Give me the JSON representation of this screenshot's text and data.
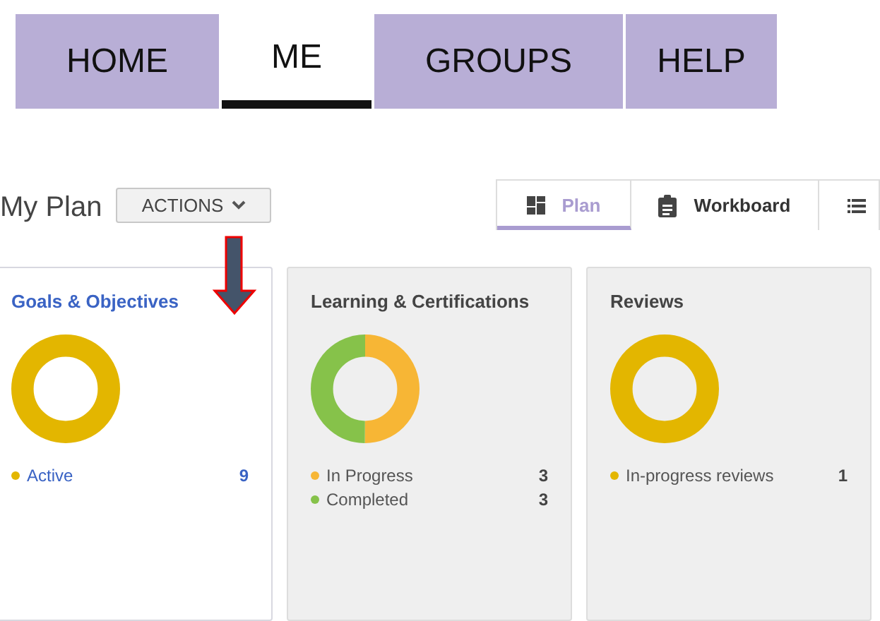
{
  "nav_tabs": [
    {
      "label": "HOME",
      "selected": false
    },
    {
      "label": "ME",
      "selected": true
    },
    {
      "label": "GROUPS",
      "selected": false
    },
    {
      "label": "HELP",
      "selected": false
    }
  ],
  "page_title": "My Plan",
  "actions_button": {
    "label": "ACTIONS"
  },
  "view_tabs": [
    {
      "label": "Plan",
      "selected": true
    },
    {
      "label": "Workboard",
      "selected": false
    },
    {
      "selected": false
    }
  ],
  "cards": [
    {
      "title": "Goals & Objectives",
      "selected": true,
      "legend": [
        {
          "label": "Active",
          "count": "9",
          "color": "#e3b600"
        }
      ]
    },
    {
      "title": "Learning & Certifications",
      "selected": false,
      "legend": [
        {
          "label": "In Progress",
          "count": "3",
          "color": "#f7b635"
        },
        {
          "label": "Completed",
          "count": "3",
          "color": "#86c24a"
        }
      ]
    },
    {
      "title": "Reviews",
      "selected": false,
      "legend": [
        {
          "label": "In-progress reviews",
          "count": "1",
          "color": "#e3b600"
        }
      ]
    }
  ]
}
